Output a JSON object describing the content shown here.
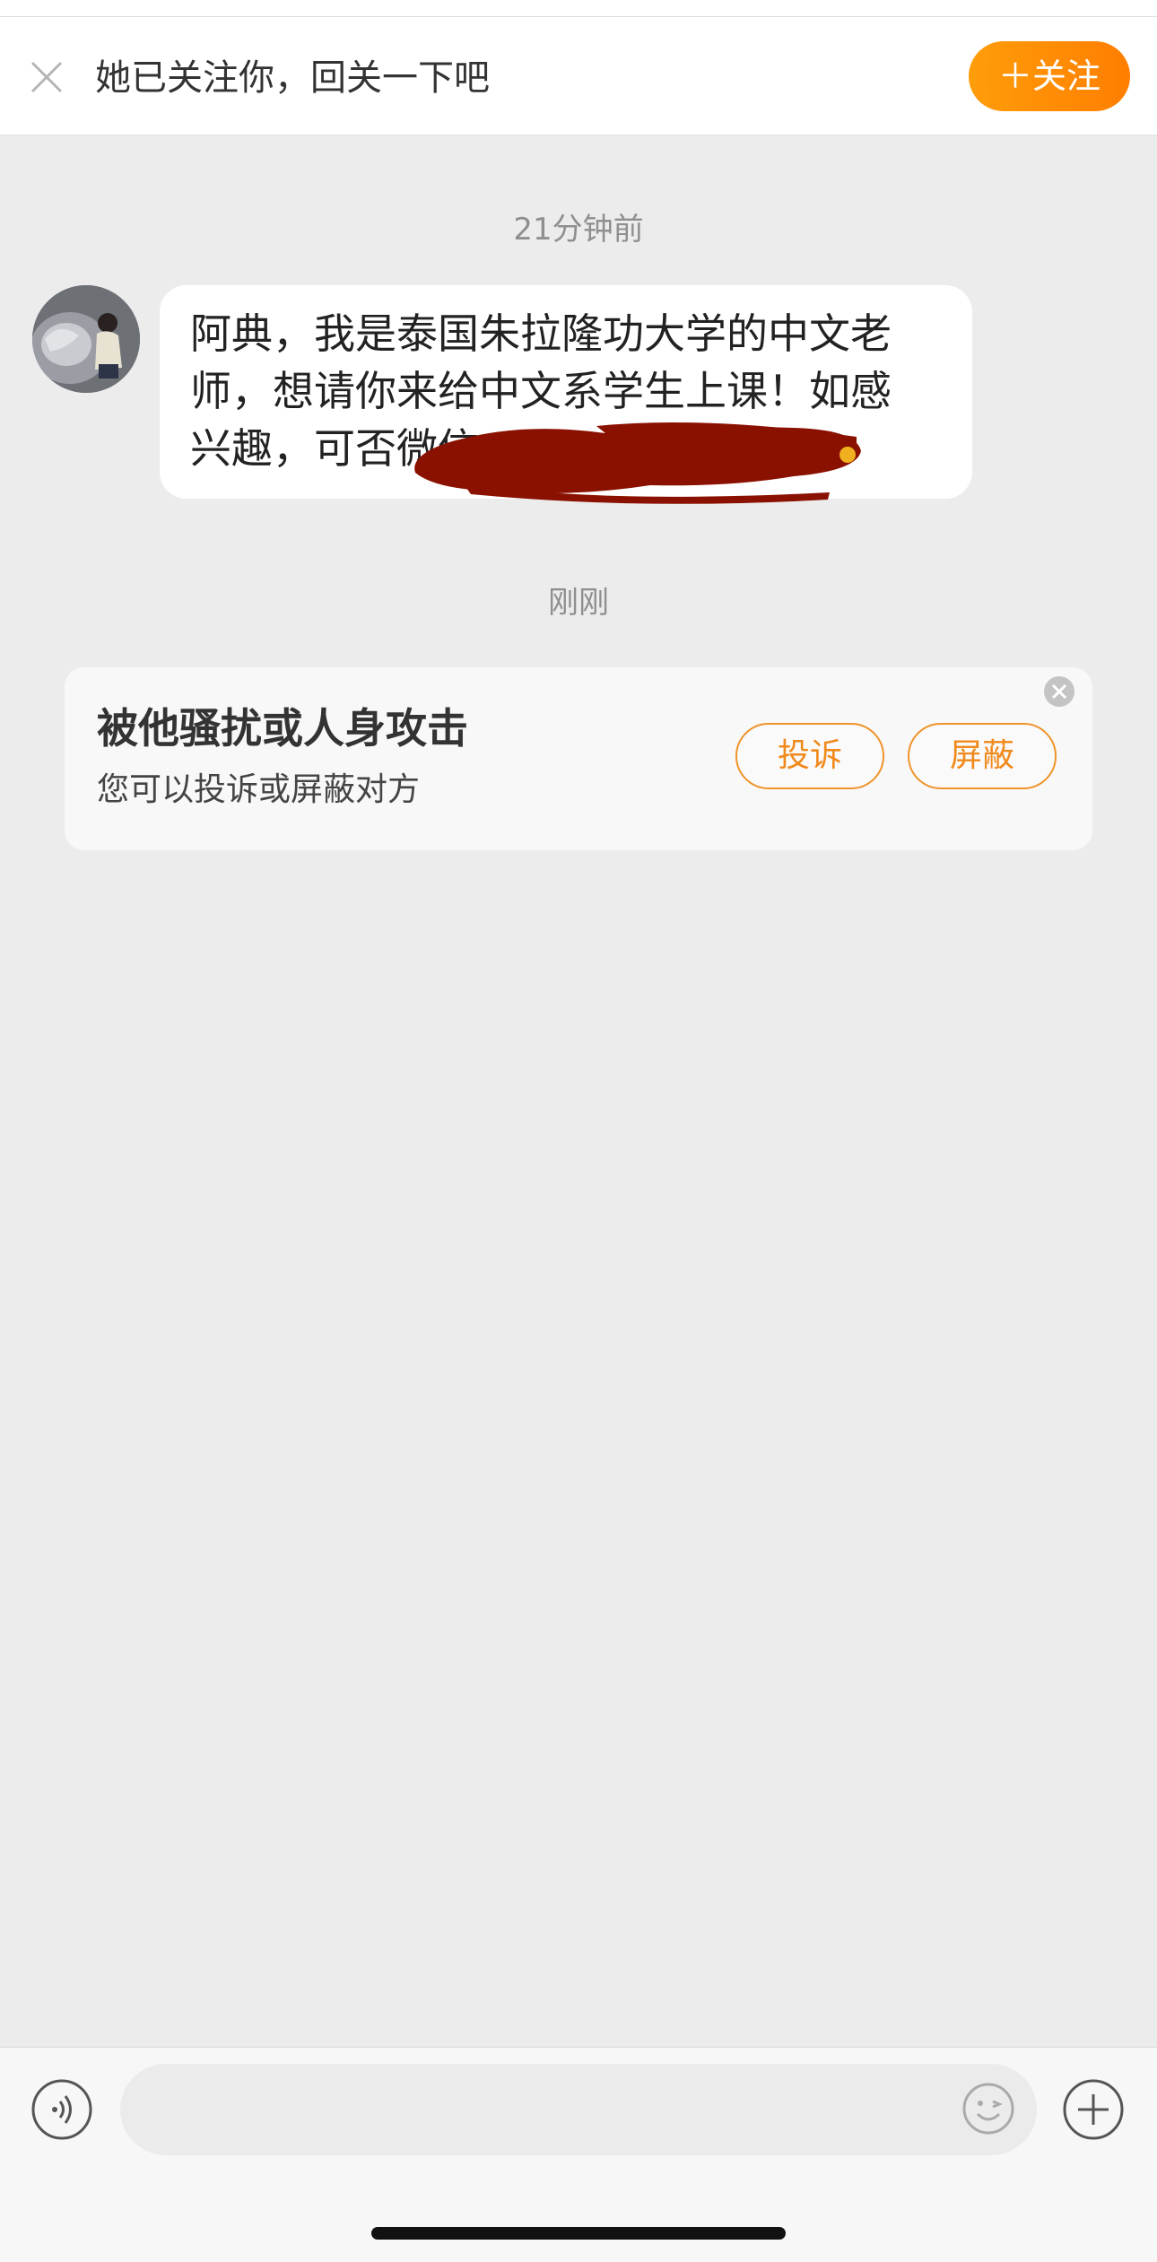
{
  "follow_bar": {
    "text": "她已关注你，回关一下吧",
    "follow_button_label": "＋关注",
    "close_icon": "close-icon"
  },
  "messages": [
    {
      "timestamp": "21分钟前",
      "sender_avatar": "avatar-photo",
      "text_lines": [
        "阿典，我是泰国朱拉隆功大学的中文老",
        "师，想请你来给中文系学生上课！如感",
        "兴趣，可否微信"
      ],
      "redacted": true
    }
  ],
  "second_timestamp": "刚刚",
  "report_card": {
    "title": "被他骚扰或人身攻击",
    "subtitle": "您可以投诉或屏蔽对方",
    "report_button": "投诉",
    "block_button": "屏蔽",
    "close_icon": "close-circle-icon"
  },
  "input_bar": {
    "placeholder": "",
    "voice_icon": "voice-icon",
    "emoji_icon": "emoji-icon",
    "plus_icon": "plus-icon"
  },
  "colors": {
    "accent_orange": "#ff8a00",
    "background": "#ececec",
    "redaction": "#8a1000"
  }
}
